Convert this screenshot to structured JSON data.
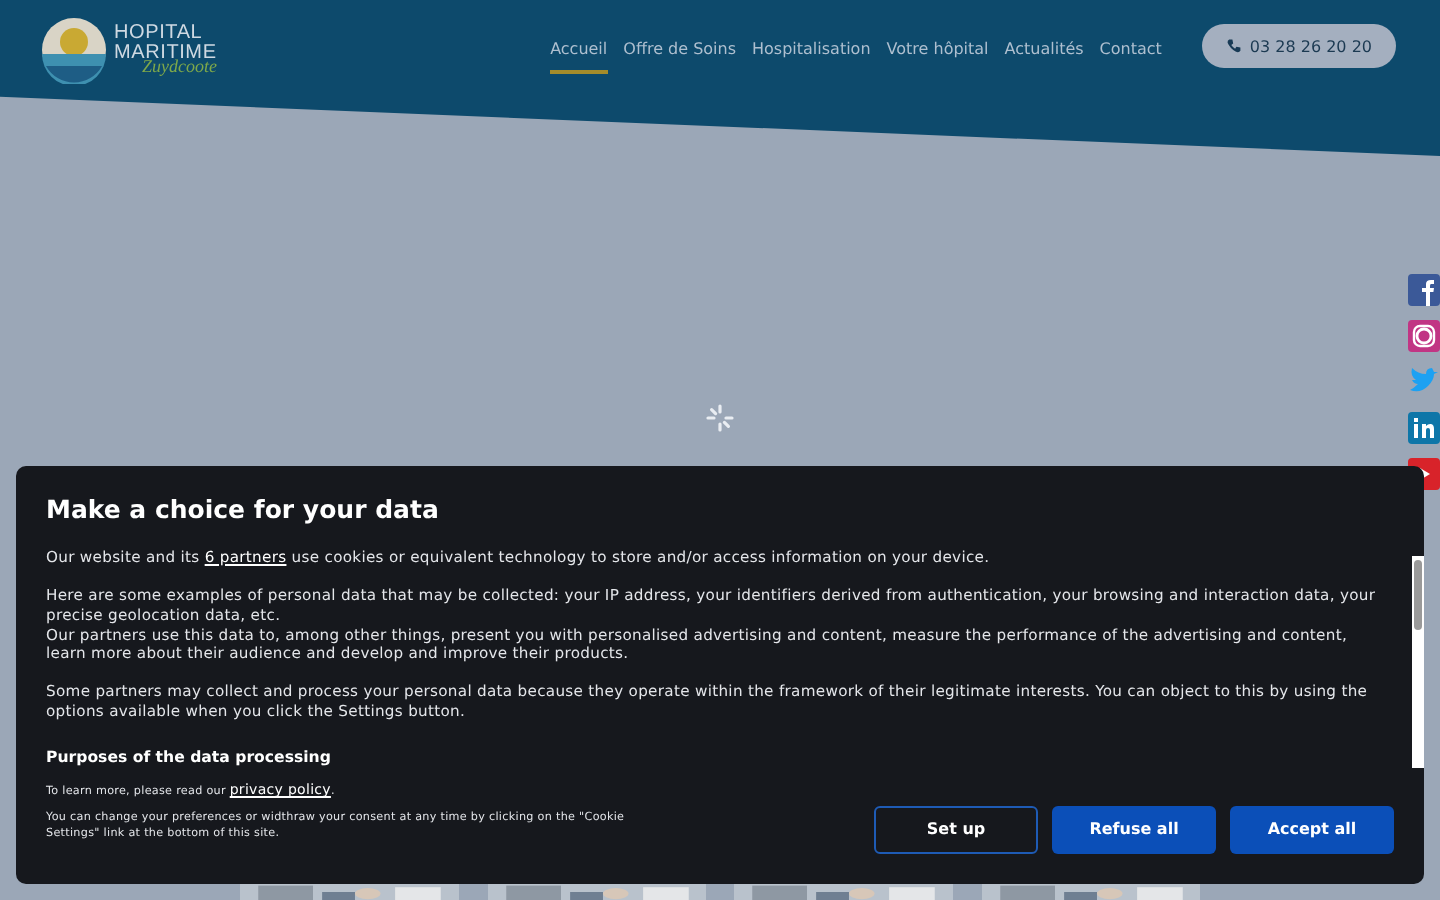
{
  "logo": {
    "line1": "HOPITAL",
    "line2": "MARITIME",
    "script": "Zuydcoote"
  },
  "nav": [
    {
      "label": "Accueil",
      "selected": true
    },
    {
      "label": "Offre de Soins",
      "selected": false
    },
    {
      "label": "Hospitalisation",
      "selected": false
    },
    {
      "label": "Votre hôpital",
      "selected": false
    },
    {
      "label": "Actualités",
      "selected": false
    },
    {
      "label": "Contact",
      "selected": false
    }
  ],
  "phone": "03 28 26 20 20",
  "social": [
    {
      "kind": "facebook",
      "color": "#3b5998"
    },
    {
      "kind": "instagram",
      "color": "#c13584"
    },
    {
      "kind": "twitter",
      "color": "#1da1f2"
    },
    {
      "kind": "linkedin",
      "color": "#0e76a8"
    },
    {
      "kind": "youtube",
      "color": "#d8232a"
    }
  ],
  "consent": {
    "title": "Make a choice for your data",
    "paragraphs": [
      "Here are some examples of personal data that may be collected: your IP address, your identifiers derived from authentication, your browsing and interaction data, your precise geolocation data, etc.\nOur partners use this data to, among other things, present you with personalised advertising and content, measure the performance of the advertising and content, learn more about their audience and develop and improve their products.",
      "Some partners may collect and process your personal data because they operate within the framework of their legitimate interests. You can object to this by using the options available when you click the Settings button."
    ],
    "partners_link": "6 partners",
    "intro_before": "Our website and its ",
    "intro_after": " use cookies or equivalent technology to store and/or access information on your device.",
    "purposes": "Purposes of the data processing",
    "learn_before": "To learn more, please read our ",
    "learn_link": "privacy policy",
    "learn_after": ".",
    "change": "You can change your preferences or widthraw your consent at any time by clicking on the \"Cookie Settings\" link at the bottom of this site.",
    "buttons": [
      {
        "label": "Set up",
        "kind": "outline"
      },
      {
        "label": "Refuse all",
        "kind": "filled"
      },
      {
        "label": "Accept all",
        "kind": "filled"
      }
    ]
  }
}
